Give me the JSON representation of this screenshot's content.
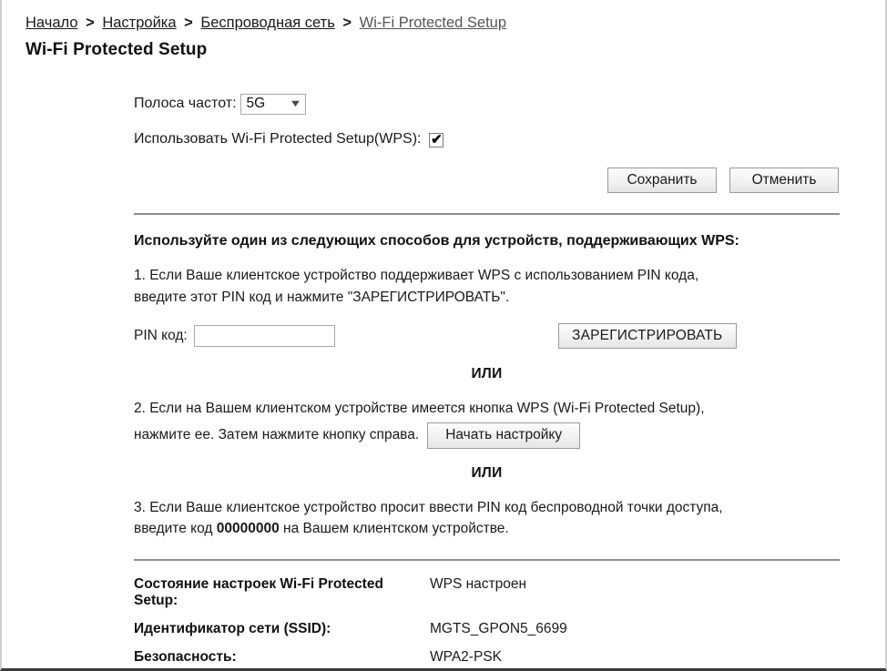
{
  "breadcrumb": {
    "items": [
      {
        "label": "Начало",
        "muted": false
      },
      {
        "label": "Настройка",
        "muted": false
      },
      {
        "label": "Беспроводная сеть",
        "muted": false
      },
      {
        "label": "Wi-Fi Protected Setup",
        "muted": true
      }
    ],
    "separator": ">"
  },
  "page_title": "Wi-Fi Protected Setup",
  "form": {
    "band_label": "Полоса частот:",
    "band_value": "5G",
    "band_options": [
      "5G"
    ],
    "band_chevron": "chevron-down-icon",
    "wps_enable_label": "Использовать Wi-Fi Protected Setup(WPS):",
    "wps_enable_checked": true,
    "wps_enable_glyph": "✔",
    "save_label": "Сохранить",
    "cancel_label": "Отменить"
  },
  "instructions": {
    "heading": "Используйте один из следующих способов для устройств, поддерживающих WPS:",
    "step1_line1": "1. Если Ваше клиентское устройство поддерживает WPS с использованием PIN кода,",
    "step1_line2": "введите этот PIN код и нажмите \"ЗАРЕГИСТРИРОВАТЬ\".",
    "pin_label": "PIN код:",
    "pin_value": "",
    "pin_placeholder": "",
    "register_label": "ЗАРЕГИСТРИРОВАТЬ",
    "or_1": "ИЛИ",
    "step2_line1": "2. Если на Вашем клиентском устройстве имеется кнопка WPS (Wi-Fi Protected Setup),",
    "step2_line2": "нажмите ее. Затем нажмите кнопку справа.",
    "start_label": "Начать настройку",
    "or_2": "ИЛИ",
    "step3_line1": "3. Если Ваше клиентское устройство просит ввести PIN код беспроводной точки доступа,",
    "step3_line2_pre": "введите код",
    "step3_pin": "00000000",
    "step3_line2_post": "на Вашем клиентском устройстве."
  },
  "status": {
    "rows": [
      {
        "key": "Состояние настроек Wi-Fi Protected Setup:",
        "value": "WPS настроен"
      },
      {
        "key": "Идентификатор сети (SSID):",
        "value": "MGTS_GPON5_6699"
      },
      {
        "key": "Безопасность:",
        "value": "WPA2-PSK"
      }
    ]
  }
}
